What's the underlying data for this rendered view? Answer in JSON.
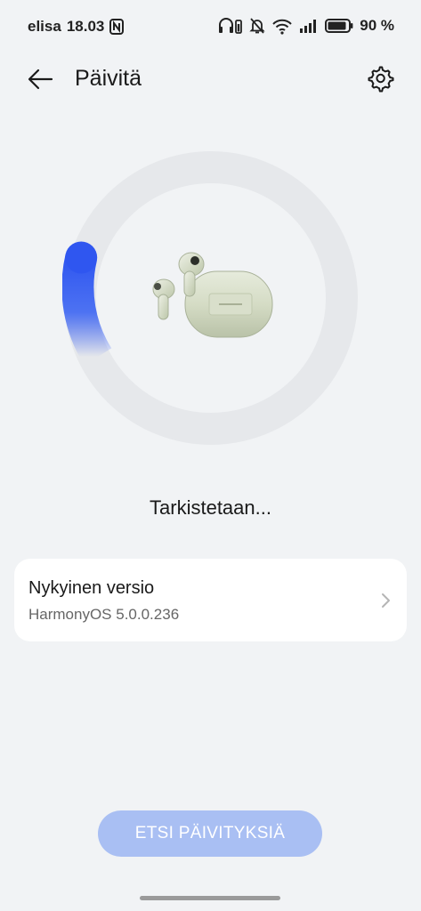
{
  "status_bar": {
    "carrier": "elisa",
    "time": "18.03",
    "battery_percent": "90 %",
    "icons": [
      "nfc-icon",
      "headphones-battery-icon",
      "bell-muted-icon",
      "wifi-icon",
      "signal-icon",
      "battery-icon"
    ]
  },
  "header": {
    "title": "Päivitä",
    "back_icon": "arrow-left-icon",
    "settings_icon": "gear-icon"
  },
  "progress": {
    "state_text": "Tarkistetaan...",
    "ring_accent": "#2f56f0",
    "ring_track": "#e6e8eb"
  },
  "version_card": {
    "title": "Nykyinen versio",
    "version": "HarmonyOS 5.0.0.236",
    "chevron_icon": "chevron-right-icon"
  },
  "action_button": {
    "label": "ETSI PÄIVITYKSIÄ",
    "disabled": true,
    "color": "#a9bff3"
  }
}
